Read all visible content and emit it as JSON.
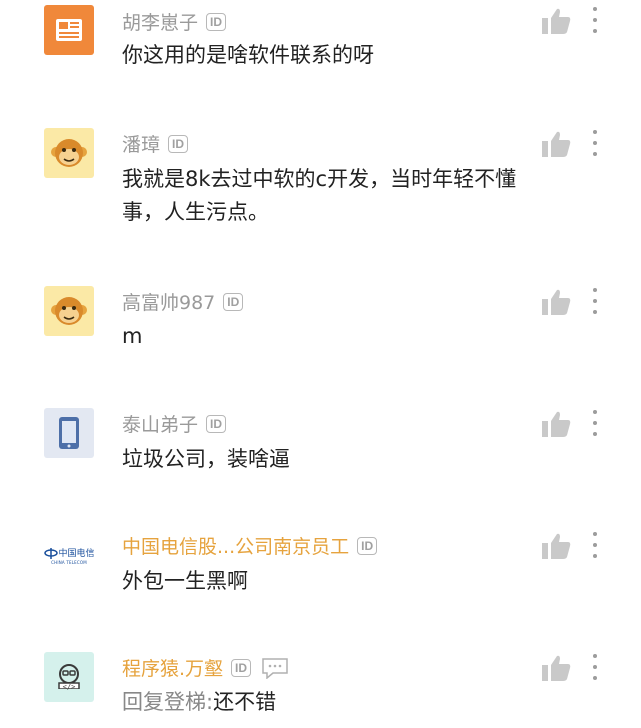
{
  "comments": [
    {
      "username": "胡李崽子",
      "id_badge": "ID",
      "content": "你这用的是啥软件联系的呀",
      "avatar": "newspaper-avatar"
    },
    {
      "username": "潘璋",
      "id_badge": "ID",
      "content": "我就是8k去过中软的c开发，当时年轻不懂事，人生污点。",
      "avatar": "monkey-avatar"
    },
    {
      "username": "高富帅987",
      "id_badge": "ID",
      "content": "m",
      "avatar": "monkey-avatar"
    },
    {
      "username": "泰山弟子",
      "id_badge": "ID",
      "content": "垃圾公司，装啥逼",
      "avatar": "phone-avatar"
    },
    {
      "username": "中国电信股...公司南京员工",
      "id_badge": "ID",
      "content": "外包一生黑啊",
      "avatar": "china-telecom-logo",
      "avatar_text": "中国电信",
      "avatar_subtext": "CHINA TELECOM"
    },
    {
      "username": "程序猿.万壑",
      "id_badge": "ID",
      "content_prefix": "回复登梯:",
      "content": "还不错",
      "avatar": "programmer-avatar",
      "avatar_text": "</>"
    }
  ],
  "colors": {
    "vip_name": "#e6a33e",
    "name": "#9a9a9a",
    "text": "#222222"
  }
}
